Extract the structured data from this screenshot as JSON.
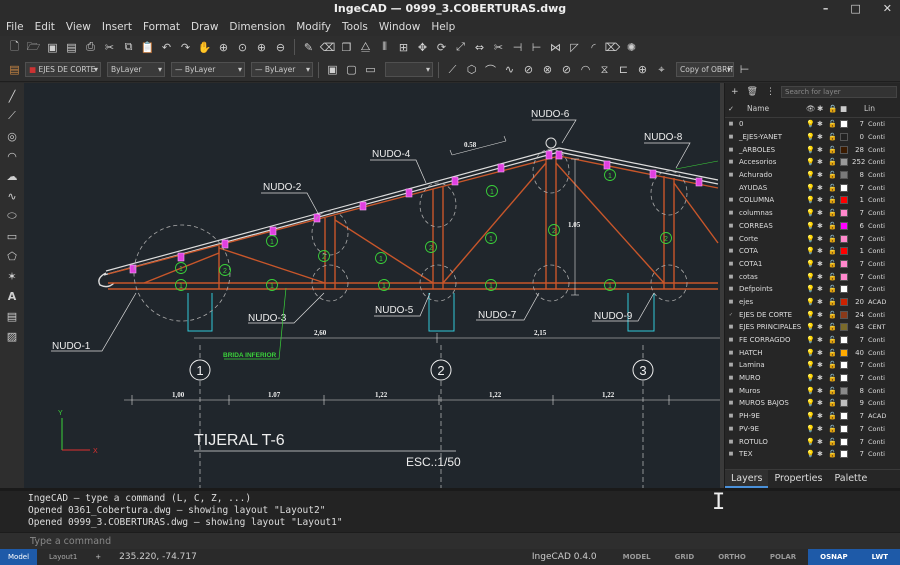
{
  "window": {
    "title": "IngeCAD — 0999_3.COBERTURAS.dwg",
    "controls": [
      "–",
      "□",
      "✕"
    ]
  },
  "menu": [
    "File",
    "Edit",
    "View",
    "Insert",
    "Format",
    "Draw",
    "Dimension",
    "Modify",
    "Tools",
    "Window",
    "Help"
  ],
  "props": {
    "layer": "EJES DE CORTE",
    "color": "ByLayer",
    "linetype": "ByLayer",
    "lineweight": "ByLayer",
    "copy": "Copy of OBRIT"
  },
  "drawing": {
    "nodes": [
      "NUDO-1",
      "NUDO-2",
      "NUDO-3",
      "NUDO-4",
      "NUDO-5",
      "NUDO-6",
      "NUDO-7",
      "NUDO-8",
      "NUDO-9"
    ],
    "dims": {
      "slope": "0.58",
      "height": "1.05",
      "span1": "2,60",
      "span2": "2,15",
      "d1": "1,00",
      "d2": "1.07",
      "d3": "1,22",
      "d4": "1,22",
      "d5": "1,22"
    },
    "axes": [
      "1",
      "2",
      "3"
    ],
    "brida": "BRIDA INFERIOR",
    "title": "TIJERAL T-6",
    "scale": "ESC.:1/50",
    "member_marks": [
      "1",
      "2"
    ]
  },
  "layers_panel": {
    "search_placeholder": "Search for layer",
    "col_name": "Name",
    "col_lin": "Lin",
    "rows": [
      {
        "name": "0",
        "num": "7",
        "color": "#ffffff",
        "lt": "Conti",
        "check": "■"
      },
      {
        "name": "_EJES-YANET",
        "num": "0",
        "color": "#222222",
        "lt": "Conti",
        "check": "■"
      },
      {
        "name": "_ARBOLES",
        "num": "28",
        "color": "#3a1a00",
        "lt": "Conti",
        "check": "■"
      },
      {
        "name": "Accesorios",
        "num": "252",
        "color": "#9a9a9a",
        "lt": "Conti",
        "check": "■"
      },
      {
        "name": "Achurado",
        "num": "8",
        "color": "#7a7a7a",
        "lt": "Conti",
        "check": "■"
      },
      {
        "name": "AYUDAS",
        "num": "7",
        "color": "#ffffff",
        "lt": "Conti",
        "check": ""
      },
      {
        "name": "COLUMNA",
        "num": "1",
        "color": "#ff0000",
        "lt": "Conti",
        "check": "■"
      },
      {
        "name": "columnas",
        "num": "7",
        "color": "#ff88cc",
        "lt": "Conti",
        "check": "■"
      },
      {
        "name": "CORREAS",
        "num": "6",
        "color": "#ff00ff",
        "lt": "Conti",
        "check": "■"
      },
      {
        "name": "Corte",
        "num": "7",
        "color": "#ff88cc",
        "lt": "Conti",
        "check": "■"
      },
      {
        "name": "COTA",
        "num": "1",
        "color": "#ff0000",
        "lt": "Conti",
        "check": "■"
      },
      {
        "name": "COTA1",
        "num": "7",
        "color": "#ff88cc",
        "lt": "Conti",
        "check": "■"
      },
      {
        "name": "cotas",
        "num": "7",
        "color": "#ff88cc",
        "lt": "Conti",
        "check": "■"
      },
      {
        "name": "Defpoints",
        "num": "7",
        "color": "#ffffff",
        "lt": "Conti",
        "check": "■"
      },
      {
        "name": "ejes",
        "num": "20",
        "color": "#cc2200",
        "lt": "ACAD",
        "check": "■"
      },
      {
        "name": "EJES DE CORTE",
        "num": "24",
        "color": "#8a3a1a",
        "lt": "Conti",
        "check": "✓"
      },
      {
        "name": "EJES PRINCIPALES",
        "num": "43",
        "color": "#7a6a2a",
        "lt": "CENT",
        "check": "■"
      },
      {
        "name": "FE CORRAGDO",
        "num": "7",
        "color": "#ffffff",
        "lt": "Conti",
        "check": "■"
      },
      {
        "name": "HATCH",
        "num": "40",
        "color": "#ffaa00",
        "lt": "Conti",
        "check": "■"
      },
      {
        "name": "Lamina",
        "num": "7",
        "color": "#ffffff",
        "lt": "Conti",
        "check": "■"
      },
      {
        "name": "MURO",
        "num": "7",
        "color": "#ffffff",
        "lt": "Conti",
        "check": "■"
      },
      {
        "name": "Muros",
        "num": "8",
        "color": "#8a8a8a",
        "lt": "Conti",
        "check": "■"
      },
      {
        "name": "MUROS BAJOS",
        "num": "9",
        "color": "#c0c0c0",
        "lt": "Conti",
        "check": "■"
      },
      {
        "name": "PH-9E",
        "num": "7",
        "color": "#ffffff",
        "lt": "ACAD",
        "check": "■"
      },
      {
        "name": "PV-9E",
        "num": "7",
        "color": "#ffffff",
        "lt": "Conti",
        "check": "■"
      },
      {
        "name": "ROTULO",
        "num": "7",
        "color": "#ffffff",
        "lt": "Conti",
        "check": "■"
      },
      {
        "name": "TEX",
        "num": "7",
        "color": "#ffffff",
        "lt": "Conti",
        "check": "■"
      }
    ],
    "tabs": [
      "Layers",
      "Properties",
      "Palette"
    ]
  },
  "console": {
    "lines": [
      "IngeCAD — type a command (L, C, Z, ...)",
      "Opened 0361_Cobertura.dwg — showing layout \"Layout2\"",
      "Opened 0999_3.COBERTURAS.dwg — showing layout \"Layout1\""
    ],
    "placeholder": "Type a command"
  },
  "status": {
    "model": "Model",
    "layout": "Layout1",
    "plus": "+",
    "coords": "235.220, -74.717",
    "version": "IngeCAD 0.4.0",
    "toggles": [
      "MODEL",
      "GRID",
      "ORTHO",
      "POLAR",
      "OSNAP",
      "LWT"
    ],
    "on": [
      "OSNAP",
      "LWT"
    ]
  }
}
